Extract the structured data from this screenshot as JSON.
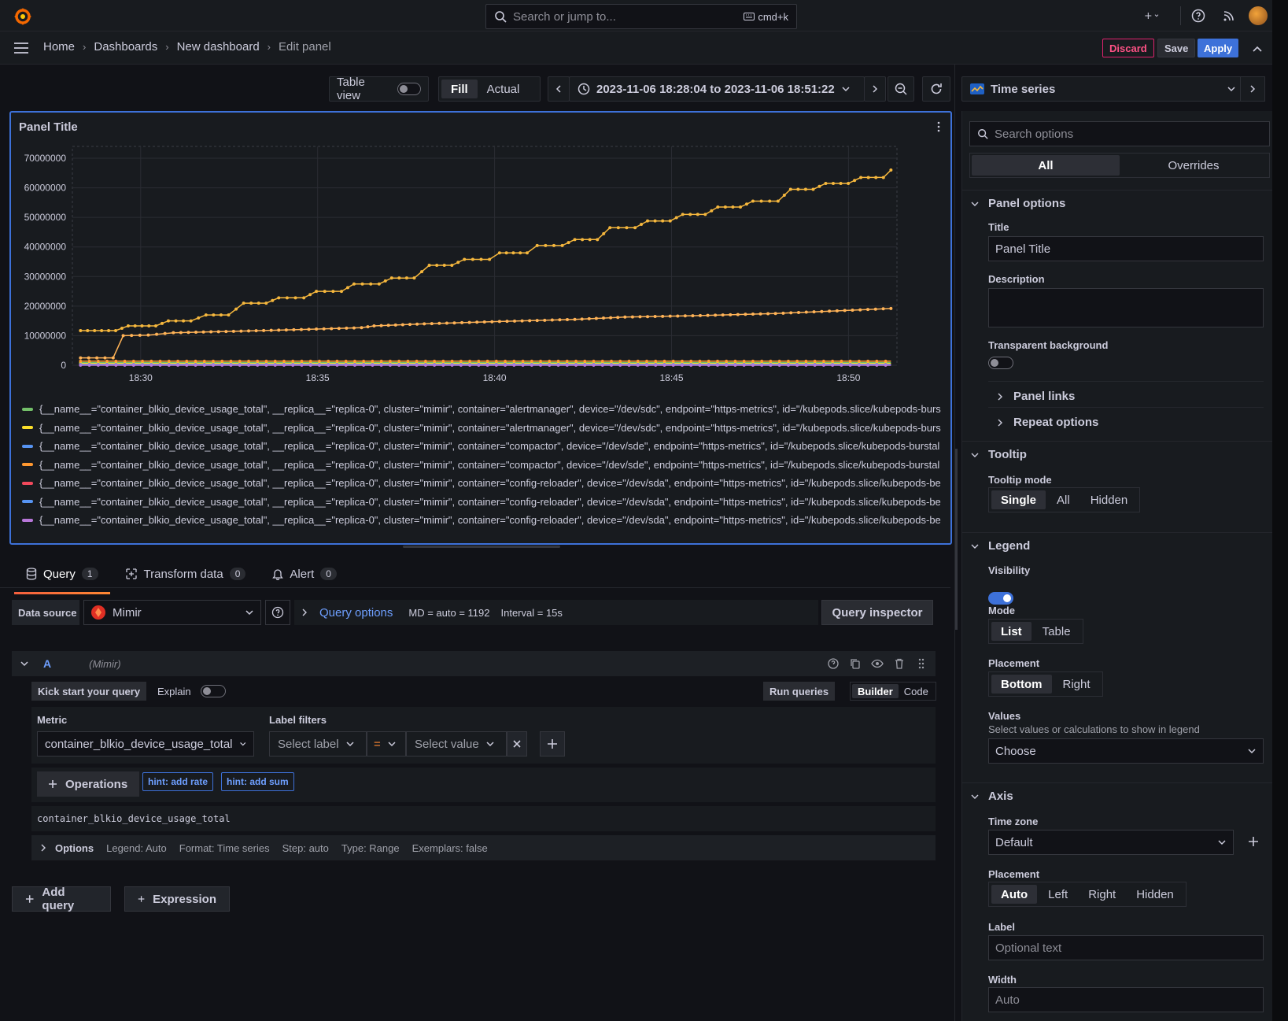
{
  "topbar": {
    "search_placeholder": "Search or jump to...",
    "shortcut": "cmd+k"
  },
  "breadcrumb": [
    "Home",
    "Dashboards",
    "New dashboard",
    "Edit panel"
  ],
  "actions": {
    "discard": "Discard",
    "save": "Save",
    "apply": "Apply"
  },
  "toolbar": {
    "table_view": "Table view",
    "fill": "Fill",
    "actual": "Actual",
    "time_range": "2023-11-06 18:28:04 to 2023-11-06 18:51:22"
  },
  "viz": {
    "name": "Time series"
  },
  "panel": {
    "title": "Panel Title"
  },
  "chart_data": {
    "type": "line",
    "title": "Panel Title",
    "x_ticks": [
      "18:30",
      "18:35",
      "18:40",
      "18:45",
      "18:50"
    ],
    "y_ticks": [
      "0",
      "10000000",
      "20000000",
      "30000000",
      "40000000",
      "50000000",
      "60000000",
      "70000000"
    ],
    "ylim": [
      0,
      74000000
    ],
    "x_minutes_range": [
      28.07,
      51.37
    ],
    "grid": true,
    "legend_placement": "bottom",
    "series": [
      {
        "name": "{__name__=\"container_blkio_device_usage_total\", __replica__=\"replica-0\", cluster=\"mimir\", container=\"alertmanager\", device=\"/dev/sdc\", endpoint=\"https-metrics\", id=\"/kubepods.slice/kubepods-burs",
        "color": "#73bf69",
        "kind": "flat",
        "level": 900000
      },
      {
        "name": "{__name__=\"container_blkio_device_usage_total\", __replica__=\"replica-0\", cluster=\"mimir\", container=\"alertmanager\", device=\"/dev/sdc\", endpoint=\"https-metrics\", id=\"/kubepods.slice/kubepods-burs",
        "color": "#fade2a",
        "kind": "flat",
        "level": 600000
      },
      {
        "name": "{__name__=\"container_blkio_device_usage_total\", __replica__=\"replica-0\", cluster=\"mimir\", container=\"compactor\", device=\"/dev/sde\", endpoint=\"https-metrics\", id=\"/kubepods.slice/kubepods-burstal",
        "color": "#5794f2",
        "kind": "flat",
        "level": 300000
      },
      {
        "name": "{__name__=\"container_blkio_device_usage_total\", __replica__=\"replica-0\", cluster=\"mimir\", container=\"compactor\", device=\"/dev/sde\", endpoint=\"https-metrics\", id=\"/kubepods.slice/kubepods-burstal",
        "color": "#ff9830",
        "kind": "flat",
        "level": 1400000
      },
      {
        "name": "{__name__=\"container_blkio_device_usage_total\", __replica__=\"replica-0\", cluster=\"mimir\", container=\"config-reloader\", device=\"/dev/sda\", endpoint=\"https-metrics\", id=\"/kubepods.slice/kubepods-be",
        "color": "#f2495c",
        "kind": "flat",
        "level": 100000
      },
      {
        "name": "{__name__=\"container_blkio_device_usage_total\", __replica__=\"replica-0\", cluster=\"mimir\", container=\"config-reloader\", device=\"/dev/sda\", endpoint=\"https-metrics\", id=\"/kubepods.slice/kubepods-be",
        "color": "#5794f2",
        "kind": "flat",
        "level": 50000
      },
      {
        "name": "{__name__=\"container_blkio_device_usage_total\", __replica__=\"replica-0\", cluster=\"mimir\", container=\"config-reloader\", device=\"/dev/sda\", endpoint=\"https-metrics\", id=\"/kubepods.slice/kubepods-be",
        "color": "#b877d9",
        "kind": "flat",
        "level": 0
      },
      {
        "name": "",
        "color": "#f5b73d",
        "kind": "steps",
        "points": [
          [
            28.3,
            11700000
          ],
          [
            29.7,
            11700000
          ],
          [
            30.2,
            13300000
          ],
          [
            31.3,
            13300000
          ],
          [
            31.8,
            15000000
          ],
          [
            32.7,
            15000000
          ],
          [
            33.3,
            17000000
          ],
          [
            34.2,
            17000000
          ],
          [
            34.8,
            21000000
          ],
          [
            35.7,
            21000000
          ],
          [
            36.2,
            22800000
          ],
          [
            37.2,
            22800000
          ],
          [
            37.7,
            25000000
          ],
          [
            38.7,
            25000000
          ],
          [
            39.2,
            27500000
          ],
          [
            40.2,
            27500000
          ],
          [
            40.7,
            29500000
          ],
          [
            41.6,
            29500000
          ],
          [
            42.2,
            33800000
          ],
          [
            43.1,
            33800000
          ],
          [
            43.6,
            35800000
          ],
          [
            44.6,
            35800000
          ],
          [
            45.0,
            38000000
          ],
          [
            46.1,
            38000000
          ],
          [
            46.5,
            40500000
          ],
          [
            47.5,
            40500000
          ],
          [
            48.0,
            42500000
          ],
          [
            48.9,
            42500000
          ],
          [
            49.4,
            46500000
          ],
          [
            50.4,
            46500000
          ],
          [
            50.9,
            48800000
          ],
          [
            51.8,
            48800000
          ],
          [
            52.3,
            51000000
          ],
          [
            53.2,
            51000000
          ],
          [
            53.7,
            53500000
          ],
          [
            54.6,
            53500000
          ],
          [
            55.1,
            55500000
          ],
          [
            56.1,
            55500000
          ],
          [
            56.6,
            59500000
          ],
          [
            57.5,
            59500000
          ],
          [
            58.0,
            61500000
          ],
          [
            58.9,
            61500000
          ],
          [
            59.4,
            63500000
          ],
          [
            60.3,
            63500000
          ],
          [
            60.6,
            66000000
          ]
        ]
      },
      {
        "name": "",
        "color": "#ffb357",
        "kind": "ramp",
        "points": [
          [
            28.3,
            2500000
          ],
          [
            29.6,
            2500000
          ],
          [
            30.0,
            10000000
          ],
          [
            31.0,
            10200000
          ],
          [
            32.0,
            11000000
          ],
          [
            35.0,
            11600000
          ],
          [
            38.0,
            12300000
          ],
          [
            39.5,
            12700000
          ],
          [
            40.0,
            13300000
          ],
          [
            42.0,
            14000000
          ],
          [
            45.0,
            14800000
          ],
          [
            48.0,
            15500000
          ],
          [
            50.0,
            16300000
          ],
          [
            53.0,
            16800000
          ],
          [
            56.0,
            17500000
          ],
          [
            60.6,
            19200000
          ]
        ]
      }
    ]
  },
  "query_tabs": [
    {
      "label": "Query",
      "count": "1"
    },
    {
      "label": "Transform data",
      "count": "0"
    },
    {
      "label": "Alert",
      "count": "0"
    }
  ],
  "datasource": {
    "label": "Data source",
    "name": "Mimir",
    "query_options": "Query options",
    "md": "MD = auto = 1192",
    "interval": "Interval = 15s",
    "inspector": "Query inspector"
  },
  "query": {
    "ref_id": "A",
    "ds": "(Mimir)",
    "kickstart": "Kick start your query",
    "explain": "Explain",
    "run": "Run queries",
    "builder": "Builder",
    "code": "Code",
    "metric_label": "Metric",
    "metric": "container_blkio_device_usage_total",
    "label_filters": "Label filters",
    "select_label": "Select label",
    "operator": "=",
    "select_value": "Select value",
    "operations": "Operations",
    "hint_rate": "hint: add rate",
    "hint_sum": "hint: add sum",
    "promql": "container_blkio_device_usage_total",
    "options_label": "Options",
    "legend": "Legend: Auto",
    "format": "Format: Time series",
    "step": "Step: auto",
    "type": "Type: Range",
    "exemplars": "Exemplars: false"
  },
  "add": {
    "query": "Add query",
    "expression": "Expression"
  },
  "options": {
    "search_placeholder": "Search options",
    "tab_all": "All",
    "tab_overrides": "Overrides",
    "panel_options": "Panel options",
    "title_label": "Title",
    "title_value": "Panel Title",
    "description_label": "Description",
    "transparent_label": "Transparent background",
    "panel_links": "Panel links",
    "repeat_options": "Repeat options",
    "tooltip": "Tooltip",
    "tooltip_mode": "Tooltip mode",
    "tooltip_modes": [
      "Single",
      "All",
      "Hidden"
    ],
    "legend": "Legend",
    "visibility": "Visibility",
    "mode": "Mode",
    "modes": [
      "List",
      "Table"
    ],
    "placement": "Placement",
    "placements": [
      "Bottom",
      "Right"
    ],
    "values": "Values",
    "values_desc": "Select values or calculations to show in legend",
    "values_choose": "Choose",
    "axis": "Axis",
    "time_zone": "Time zone",
    "time_zone_value": "Default",
    "axis_placement": "Placement",
    "axis_placements": [
      "Auto",
      "Left",
      "Right",
      "Hidden"
    ],
    "label": "Label",
    "label_placeholder": "Optional text",
    "width": "Width",
    "width_placeholder": "Auto"
  }
}
